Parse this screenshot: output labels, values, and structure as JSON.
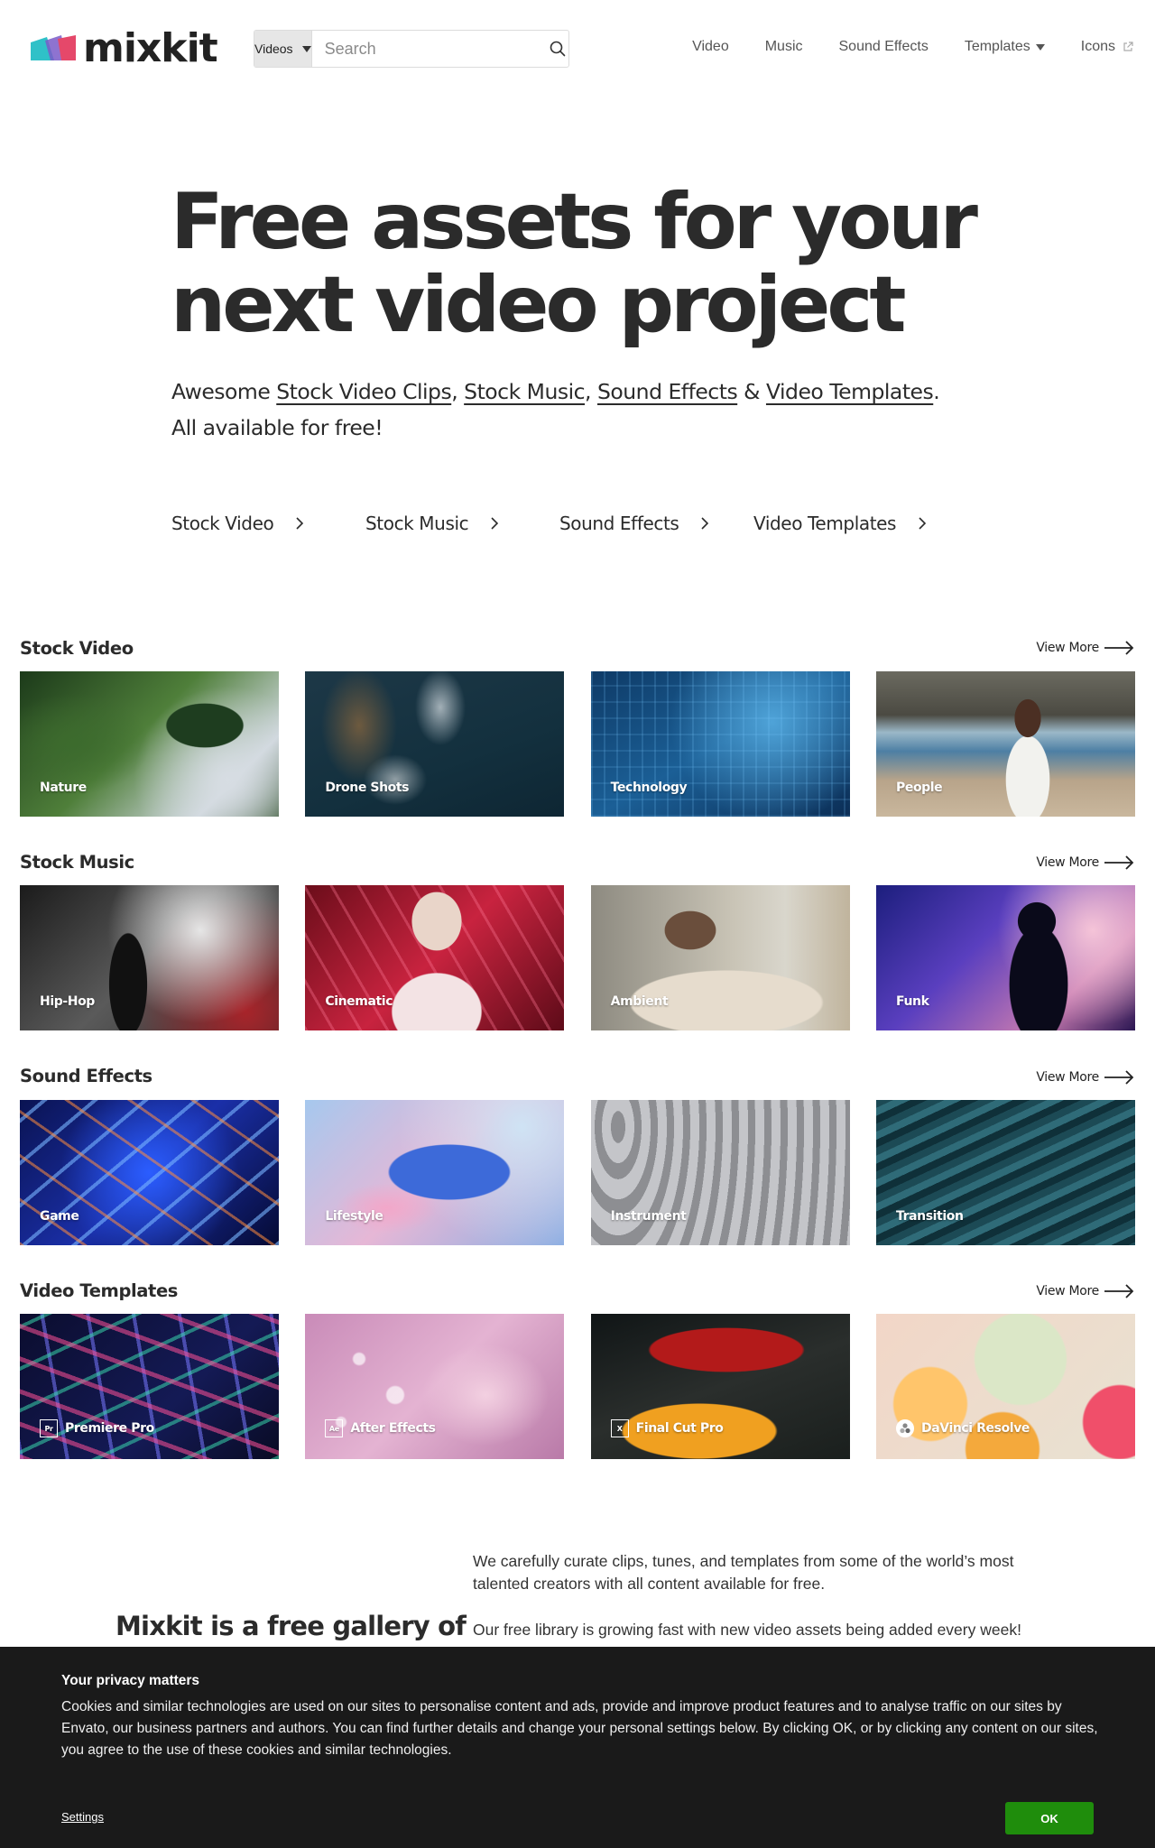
{
  "header": {
    "logo_text": "mixkit",
    "search": {
      "type_label": "Videos",
      "placeholder": "Search"
    },
    "nav": [
      {
        "label": "Video"
      },
      {
        "label": "Music"
      },
      {
        "label": "Sound Effects"
      },
      {
        "label": "Templates"
      },
      {
        "label": "Icons"
      }
    ]
  },
  "hero": {
    "title_line1": "Free assets for your",
    "title_line2": "next video project",
    "sub_prefix": "Awesome ",
    "sub_link1": "Stock Video Clips",
    "sub_comma1": ", ",
    "sub_link2": "Stock Music",
    "sub_comma2": ", ",
    "sub_link3": "Sound Effects",
    "sub_amp": " & ",
    "sub_link4": "Video Templates",
    "sub_period": ".",
    "sub_line2": "All available for free!",
    "quicklinks": [
      {
        "label": "Stock Video"
      },
      {
        "label": "Stock Music"
      },
      {
        "label": "Sound Effects"
      },
      {
        "label": "Video Templates"
      }
    ]
  },
  "sections": [
    {
      "title": "Stock Video",
      "view_more": "View More",
      "cards": [
        {
          "label": "Nature"
        },
        {
          "label": "Drone Shots"
        },
        {
          "label": "Technology"
        },
        {
          "label": "People"
        }
      ]
    },
    {
      "title": "Stock Music",
      "view_more": "View More",
      "cards": [
        {
          "label": "Hip-Hop"
        },
        {
          "label": "Cinematic"
        },
        {
          "label": "Ambient"
        },
        {
          "label": "Funk"
        }
      ]
    },
    {
      "title": "Sound Effects",
      "view_more": "View More",
      "cards": [
        {
          "label": "Game"
        },
        {
          "label": "Lifestyle"
        },
        {
          "label": "Instrument"
        },
        {
          "label": "Transition"
        }
      ]
    },
    {
      "title": "Video Templates",
      "view_more": "View More",
      "cards": [
        {
          "label": "Premiere Pro",
          "badge": "Pr"
        },
        {
          "label": "After Effects",
          "badge": "Ae"
        },
        {
          "label": "Final Cut Pro",
          "badge": "X"
        },
        {
          "label": "DaVinci Resolve",
          "badge": ""
        }
      ]
    }
  ],
  "about": {
    "heading": "Mixkit is a free gallery of",
    "paragraph1": "We carefully curate clips, tunes, and templates from some of the world’s most talented creators with all content available for free.",
    "paragraph2": "Our free library is growing fast with new video assets being added every week!"
  },
  "cookie": {
    "title": "Your privacy matters",
    "body": "Cookies and similar technologies are used on our sites to personalise content and ads, provide and improve product features and to analyse traffic on our sites by Envato, our business partners and authors. You can find further details and change your personal settings below. By clicking OK, or by clicking any content on our sites, you agree to the use of these cookies and similar technologies.",
    "settings_label": "Settings",
    "ok_label": "OK"
  },
  "colors": {
    "ok_button": "#1f8d0c",
    "banner_bg": "#1a1a1a",
    "logo_teal": "#2fc1c8",
    "logo_pink": "#e5486a"
  }
}
